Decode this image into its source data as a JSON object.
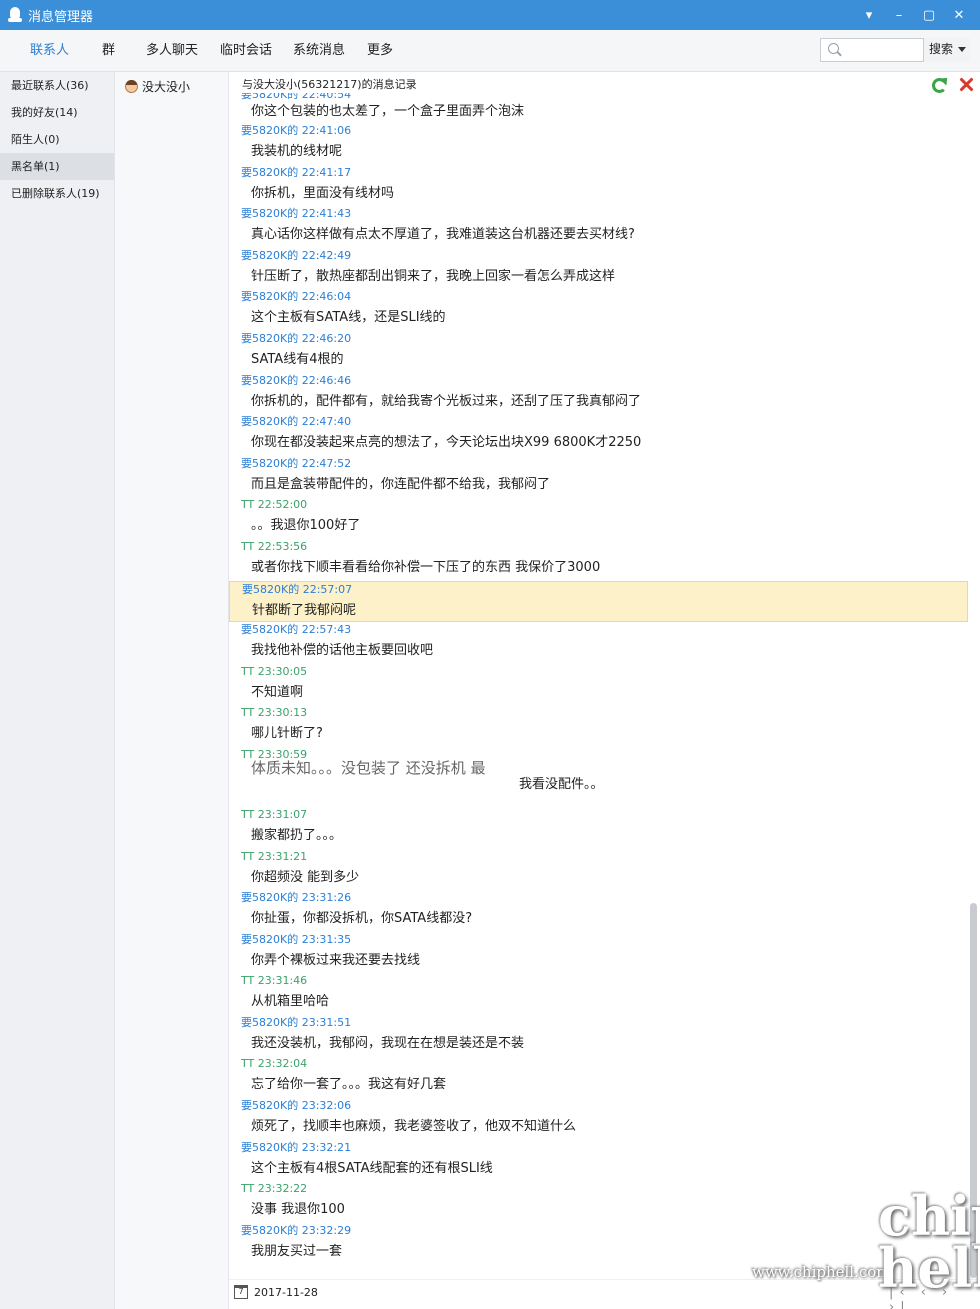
{
  "window": {
    "title": "消息管理器",
    "buttons": [
      "▾",
      "–",
      "▢",
      "✕"
    ]
  },
  "nav": {
    "tabs": [
      "联系人",
      "群",
      "多人聊天",
      "临时会话",
      "系统消息",
      "更多"
    ],
    "active_tab": "联系人",
    "search_placeholder": "",
    "search_button": "搜索"
  },
  "sidebar": {
    "items": [
      {
        "label": "最近联系人(36)"
      },
      {
        "label": "我的好友(14)"
      },
      {
        "label": "陌生人(0)"
      },
      {
        "label": "黑名单(1)"
      },
      {
        "label": "已删除联系人(19)"
      }
    ],
    "selected": "黑名单(1)"
  },
  "contact": {
    "name": "没大没小"
  },
  "conversation": {
    "header": "与没大没小(56321217)的消息记录",
    "partial_top_meta": "要5820K的 22:40:54",
    "messages": [
      {
        "meta": "",
        "sender": "me",
        "text": "你这个包装的也太差了，一个盒子里面弄个泡沫"
      },
      {
        "meta": "要5820K的 22:41:06",
        "sender": "me",
        "text": "我装机的线材呢"
      },
      {
        "meta": "要5820K的 22:41:17",
        "sender": "me",
        "text": "你拆机，里面没有线材吗"
      },
      {
        "meta": "要5820K的 22:41:43",
        "sender": "me",
        "text": "真心话你这样做有点太不厚道了，我难道装这台机器还要去买材线?"
      },
      {
        "meta": "要5820K的 22:42:49",
        "sender": "me",
        "text": "针压断了，散热座都刮出铜来了，我晚上回家一看怎么弄成这样"
      },
      {
        "meta": "要5820K的 22:46:04",
        "sender": "me",
        "text": "这个主板有SATA线，还是SLI线的"
      },
      {
        "meta": "要5820K的 22:46:20",
        "sender": "me",
        "text": "SATA线有4根的"
      },
      {
        "meta": "要5820K的 22:46:46",
        "sender": "me",
        "text": "你拆机的，配件都有，就给我寄个光板过来，还刮了压了我真郁闷了"
      },
      {
        "meta": "要5820K的 22:47:40",
        "sender": "me",
        "text": "你现在都没装起来点亮的想法了，今天论坛出块X99  6800K才2250"
      },
      {
        "meta": "要5820K的 22:47:52",
        "sender": "me",
        "text": "而且是盒装带配件的，你连配件都不给我，我郁闷了"
      },
      {
        "meta": "TT 22:52:00",
        "sender": "other",
        "text": "。。我退你100好了"
      },
      {
        "meta": "TT 22:53:56",
        "sender": "other",
        "text": "或者你找下顺丰看看给你补偿一下压了的东西 我保价了3000"
      },
      {
        "meta": "要5820K的 22:57:07",
        "sender": "me",
        "text": "针都断了我郁闷呢",
        "highlight": true
      },
      {
        "meta": "要5820K的 22:57:43",
        "sender": "me",
        "text": "我找他补偿的话他主板要回收吧"
      },
      {
        "meta": "TT 23:30:05",
        "sender": "other",
        "text": "不知道啊"
      },
      {
        "meta": "TT 23:30:13",
        "sender": "other",
        "text": "哪儿针断了?"
      },
      {
        "meta": "TT 23:30:59",
        "sender": "other",
        "text": "体质未知。。。没包装了 还没拆机 最",
        "text2": "我看没配件。。",
        "big": true
      },
      {
        "meta": "TT 23:31:07",
        "sender": "other",
        "text": "搬家都扔了。。。"
      },
      {
        "meta": "TT 23:31:21",
        "sender": "other",
        "text": "你超频没 能到多少"
      },
      {
        "meta": "要5820K的 23:31:26",
        "sender": "me",
        "text": "你扯蛋，你都没拆机，你SATA线都没?"
      },
      {
        "meta": "要5820K的 23:31:35",
        "sender": "me",
        "text": "你弄个裸板过来我还要去找线"
      },
      {
        "meta": "TT 23:31:46",
        "sender": "other",
        "text": "从机箱里哈哈"
      },
      {
        "meta": "要5820K的 23:31:51",
        "sender": "me",
        "text": "我还没装机，我郁闷，我现在在想是装还是不装"
      },
      {
        "meta": "TT 23:32:04",
        "sender": "other",
        "text": "忘了给你一套了。。。我这有好几套"
      },
      {
        "meta": "要5820K的 23:32:06",
        "sender": "me",
        "text": "烦死了，找顺丰也麻烦，我老婆签收了，他双不知道什么"
      },
      {
        "meta": "要5820K的 23:32:21",
        "sender": "me",
        "text": "这个主板有4根SATA线配套的还有根SLI线"
      },
      {
        "meta": "TT 23:32:22",
        "sender": "other",
        "text": "没事 我退你100"
      },
      {
        "meta": "要5820K的 23:32:29",
        "sender": "me",
        "text": "我朋友买过一套"
      }
    ],
    "footer_date": "2017-11-28",
    "pager": "|‹ ‹ › ›|"
  },
  "watermark": {
    "url": "www.chiphell.com",
    "logo": "chip hell"
  },
  "colors": {
    "titlebar": "#3b8ed8",
    "me_meta": "#2a7fd6",
    "other_meta": "#3aa36a",
    "highlight": "#fdf1c9"
  }
}
